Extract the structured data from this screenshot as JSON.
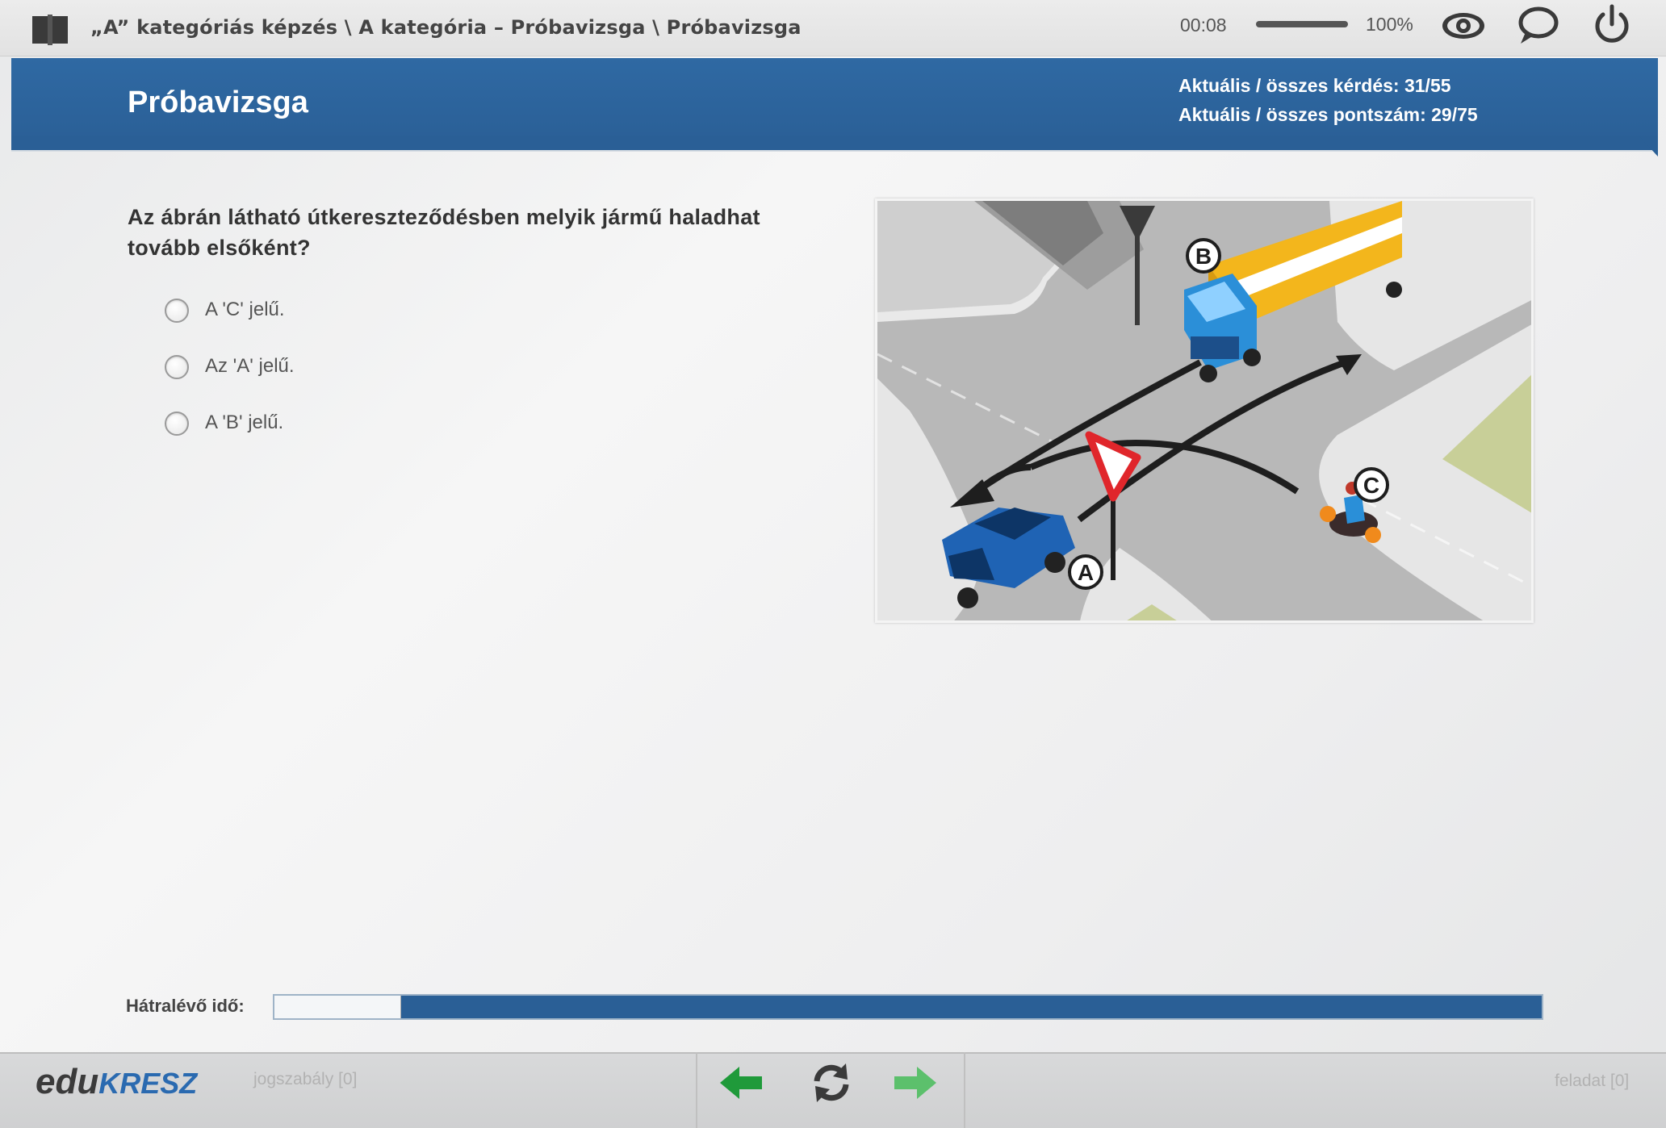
{
  "topbar": {
    "breadcrumb": "„A” kategóriás képzés \\ A kategória – Próbavizsga \\ Próbavizsga",
    "elapsed_time": "00:08",
    "zoom": "100%",
    "icons": [
      "book-icon",
      "eye-icon",
      "chat-icon",
      "power-icon"
    ]
  },
  "header": {
    "title": "Próbavizsga",
    "question_counter": "Aktuális / összes kérdés: 31/55",
    "score_counter": "Aktuális / összes pontszám: 29/75"
  },
  "question": {
    "text": "Az ábrán látható útkereszteződésben melyik jármű haladhat tovább elsőként?",
    "answers": [
      {
        "label": "A 'C' jelű."
      },
      {
        "label": "Az 'A' jelű."
      },
      {
        "label": "A 'B' jelű."
      }
    ],
    "figure_labels": {
      "a": "A",
      "b": "B",
      "c": "C"
    }
  },
  "remaining_time": {
    "label": "Hátralévő idő:",
    "elapsed_fraction": 0.1
  },
  "footer": {
    "logo_edu": "edu",
    "logo_kresz": "KRESZ",
    "law_link": "jogszabály [0]",
    "task_link": "feladat [0]",
    "icons": [
      "arrow-left-icon",
      "reload-icon",
      "arrow-right-icon"
    ]
  },
  "colors": {
    "header_blue": "#2a5f96",
    "nav_green": "#1f9a3a",
    "nav_green_light": "#5cc06c"
  }
}
